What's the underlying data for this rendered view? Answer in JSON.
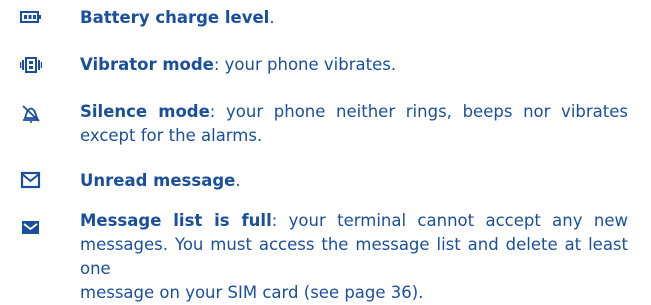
{
  "entries": [
    {
      "icon": "battery-icon",
      "term": "Battery charge level",
      "desc": "."
    },
    {
      "icon": "vibrate-icon",
      "term": "Vibrator mode",
      "desc": ": your phone vibrates."
    },
    {
      "icon": "silence-icon",
      "term": "Silence mode",
      "desc_line1": ": your phone neither rings, beeps nor vibrates",
      "desc_line2": "except for the alarms."
    },
    {
      "icon": "unread-message-icon",
      "term": "Unread message",
      "desc": "."
    },
    {
      "icon": "message-list-full-icon",
      "term": "Message list is full",
      "desc_line1": ": your terminal cannot accept any new",
      "desc_line2": "messages. You must access the message list and delete at least one",
      "desc_line3": "message on your SIM card (see page 36)."
    }
  ],
  "colors": {
    "text": "#1a4f9c",
    "icon": "#1a4f9c"
  }
}
